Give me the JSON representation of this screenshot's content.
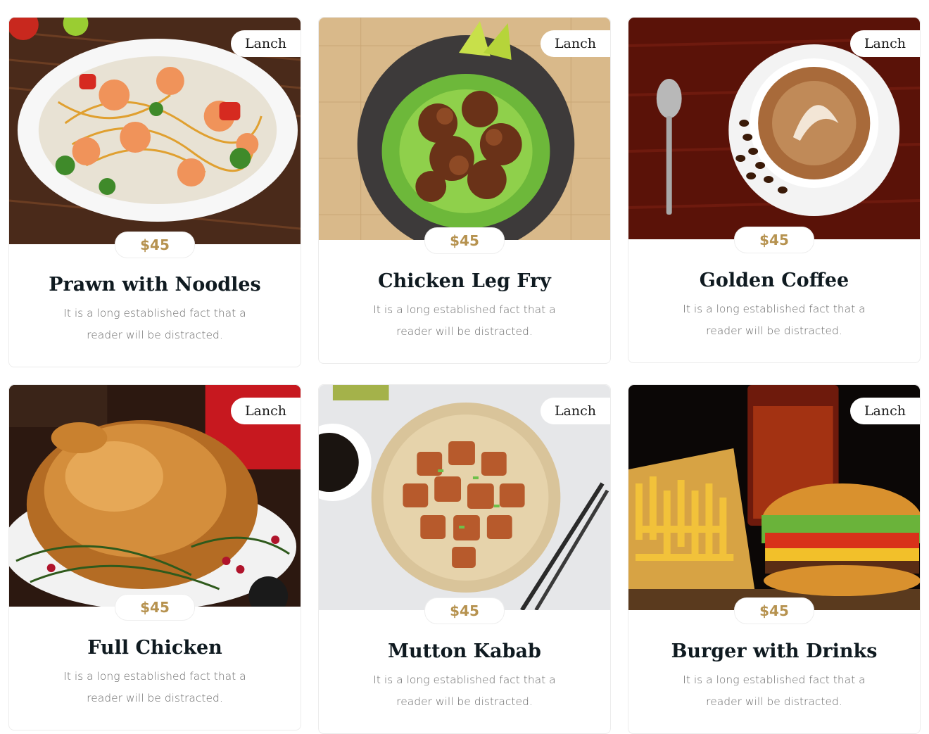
{
  "cards": [
    {
      "tag": "Lanch",
      "price": "$45",
      "title": "Prawn with Noodles",
      "desc": "It is a long established fact that a reader will be distracted."
    },
    {
      "tag": "Lanch",
      "price": "$45",
      "title": "Chicken Leg Fry",
      "desc": "It is a long established fact that a reader will be distracted."
    },
    {
      "tag": "Lanch",
      "price": "$45",
      "title": "Golden Coffee",
      "desc": "It is a long established fact that a reader will be distracted."
    },
    {
      "tag": "Lanch",
      "price": "$45",
      "title": "Full Chicken",
      "desc": "It is a long established fact that a reader will be distracted."
    },
    {
      "tag": "Lanch",
      "price": "$45",
      "title": "Mutton Kabab",
      "desc": "It is a long established fact that a reader will be distracted."
    },
    {
      "tag": "Lanch",
      "price": "$45",
      "title": "Burger with Drinks",
      "desc": "It is a long established fact that a reader will be distracted."
    }
  ],
  "colors": {
    "price": "#b6924f",
    "title": "#0f1a20",
    "text": "#6b6b6b"
  }
}
